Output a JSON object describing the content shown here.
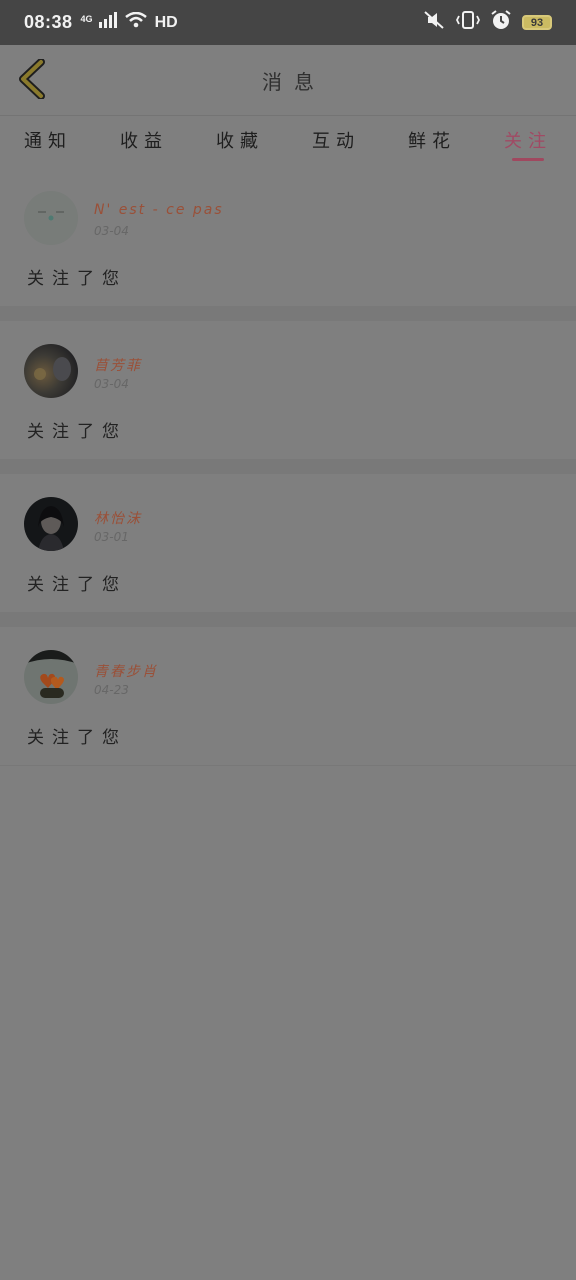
{
  "status_bar": {
    "time": "08:38",
    "network": "4G",
    "wifi_label": "HD",
    "battery": "93",
    "icons": [
      "signal-icon",
      "wifi-icon",
      "mute-icon",
      "vibrate-icon",
      "alarm-icon",
      "battery-icon"
    ]
  },
  "header": {
    "title": "消息",
    "back_icon": "chevron-left-icon"
  },
  "tabs": [
    {
      "label": "通知",
      "active": false
    },
    {
      "label": "收益",
      "active": false
    },
    {
      "label": "收藏",
      "active": false
    },
    {
      "label": "互动",
      "active": false
    },
    {
      "label": "鲜花",
      "active": false
    },
    {
      "label": "关注",
      "active": true
    }
  ],
  "notifications": [
    {
      "name": "N' est - ce pas",
      "date": "03-04",
      "message": "关注了您",
      "avatar": "face-avatar"
    },
    {
      "name": "苜芳菲",
      "date": "03-04",
      "message": "关注了您",
      "avatar": "photo-avatar"
    },
    {
      "name": "林怡沫",
      "date": "03-01",
      "message": "关注了您",
      "avatar": "photo-avatar"
    },
    {
      "name": "青春步肖",
      "date": "04-23",
      "message": "关注了您",
      "avatar": "photo-avatar"
    }
  ],
  "colors": {
    "overlay": "#7f7f7f",
    "accent": "#a0485f",
    "name": "#9a5038"
  }
}
